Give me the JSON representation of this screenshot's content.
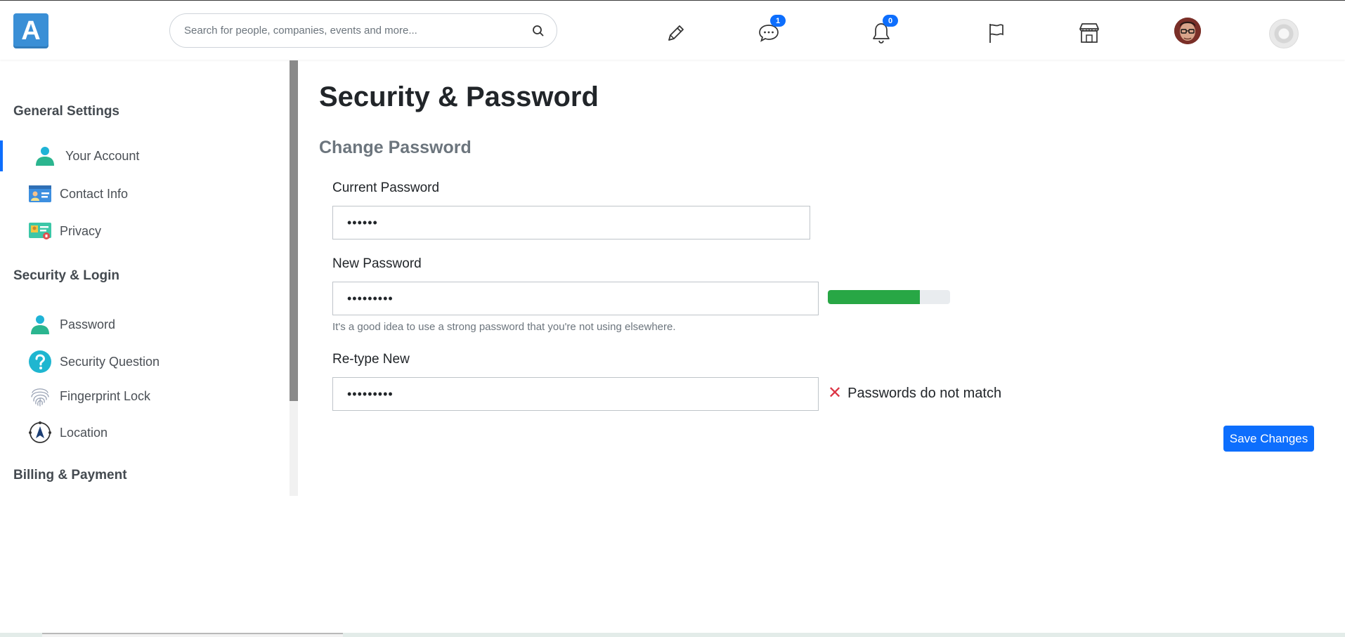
{
  "app": {
    "logo_letter": "A"
  },
  "search": {
    "placeholder": "Search for people, companies, events and more..."
  },
  "nav": {
    "messages_badge": "1",
    "notifications_badge": "0"
  },
  "sidebar": {
    "sections": [
      {
        "title": "General Settings"
      },
      {
        "title": "Security & Login"
      },
      {
        "title": "Billing & Payment"
      }
    ],
    "items": [
      {
        "label": "Your Account",
        "icon": "user-icon"
      },
      {
        "label": "Contact Info",
        "icon": "contact-card-icon"
      },
      {
        "label": "Privacy",
        "icon": "id-card-icon"
      },
      {
        "label": "Password",
        "icon": "user-icon"
      },
      {
        "label": "Security Question",
        "icon": "question-icon"
      },
      {
        "label": "Fingerprint Lock",
        "icon": "fingerprint-icon"
      },
      {
        "label": "Location",
        "icon": "location-compass-icon"
      }
    ]
  },
  "main": {
    "title": "Security & Password",
    "subtitle": "Change Password",
    "current_label": "Current Password",
    "current_value": "••••••",
    "new_label": "New Password",
    "new_value": "•••••••••",
    "new_strength_fraction": 0.75,
    "hint": "It's a good idea to use a strong password that you're not using elsewhere.",
    "retype_label": "Re-type New",
    "retype_value": "•••••••••",
    "mismatch_text": "Passwords do not match",
    "save_label": "Save Changes"
  },
  "colors": {
    "primary": "#0d6efd",
    "success": "#28a745",
    "danger": "#dc3545",
    "logo": "#3a8fd6"
  }
}
